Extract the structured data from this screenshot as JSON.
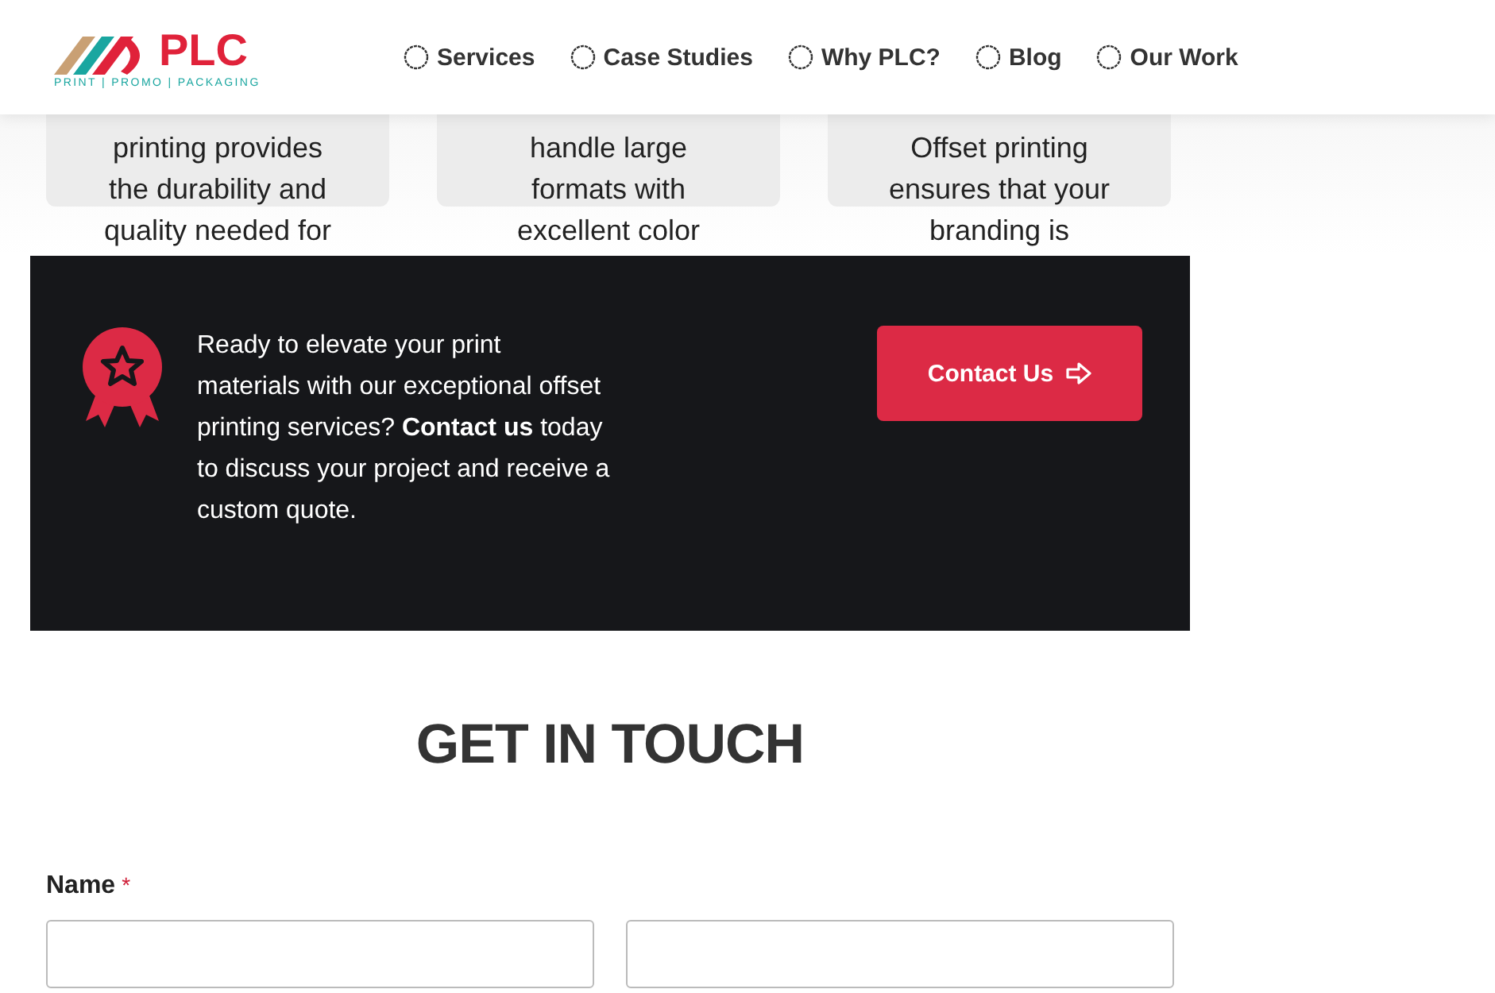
{
  "header": {
    "logo": {
      "name": "PLC",
      "tagline": "PRINT | PROMO | PACKAGING"
    },
    "nav": [
      {
        "label": "Services"
      },
      {
        "label": "Case Studies"
      },
      {
        "label": "Why PLC?"
      },
      {
        "label": "Blog"
      },
      {
        "label": "Our Work"
      }
    ]
  },
  "cards": [
    {
      "lines": [
        "printing provides",
        "the durability and",
        "quality needed for"
      ]
    },
    {
      "lines": [
        "handle large",
        "formats with",
        "excellent color"
      ]
    },
    {
      "lines": [
        "Offset printing",
        "ensures that your",
        "branding is"
      ]
    }
  ],
  "banner": {
    "text": "Ready to elevate your print materials with our exceptional offset printing services? **Contact us** today to discuss your project and receive a custom quote.",
    "button": "Contact Us"
  },
  "contact": {
    "title": "GET IN TOUCH",
    "name_label": "Name",
    "required_mark": "*"
  }
}
